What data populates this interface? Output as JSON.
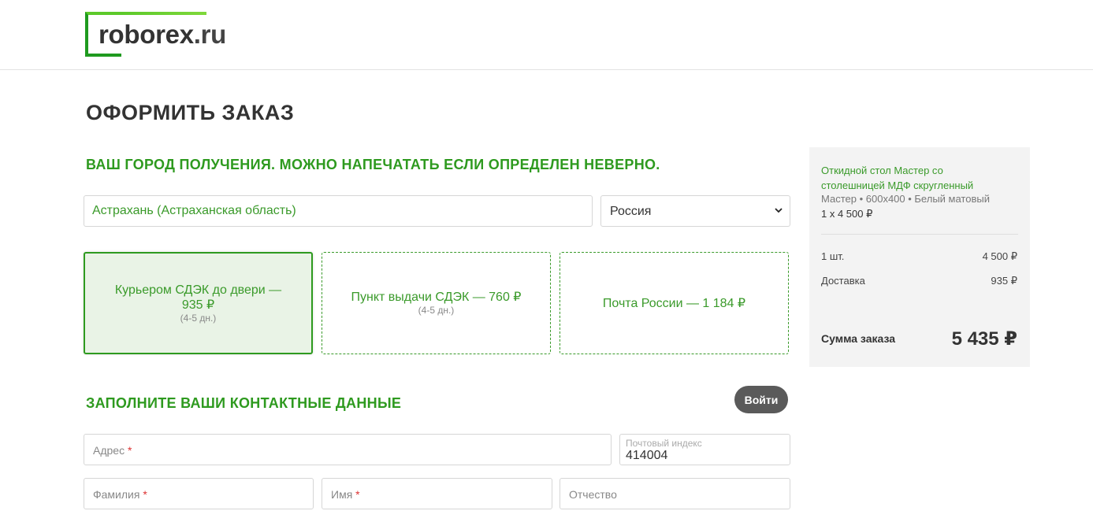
{
  "header": {
    "logo_main": "roborex",
    "logo_tld": ".ru"
  },
  "page": {
    "title": "ОФОРМИТЬ ЗАКАЗ"
  },
  "city_section": {
    "title": "ВАШ ГОРОД ПОЛУЧЕНИЯ. МОЖНО НАПЕЧАТАТЬ ЕСЛИ ОПРЕДЕЛЕН НЕВЕРНО.",
    "city_value": "Астрахань (Астраханская область)",
    "country_selected": "Россия"
  },
  "delivery_options": [
    {
      "label": "Курьером СДЭК до двери — 935 ₽",
      "term": "(4-5 дн.)",
      "selected": true
    },
    {
      "label": "Пункт выдачи СДЭК — 760 ₽",
      "term": "(4-5 дн.)",
      "selected": false
    },
    {
      "label": "Почта России — 1 184 ₽",
      "term": "",
      "selected": false
    }
  ],
  "contacts_section": {
    "title": "ЗАПОЛНИТЕ ВАШИ КОНТАКТНЫЕ ДАННЫЕ",
    "login_label": "Войти",
    "address_placeholder": "Адрес",
    "postal_label": "Почтовый индекс",
    "postal_value": "414004",
    "lastname_placeholder": "Фамилия",
    "firstname_placeholder": "Имя",
    "middlename_placeholder": "Отчество",
    "required_mark": "*"
  },
  "summary": {
    "product_name": "Откидной стол Мастер со столешницей МДФ скругленный",
    "product_spec": "Мастер • 600x400 • Белый матовый",
    "product_qty": "1 x 4 500 ₽",
    "qty_label": "1 шт.",
    "qty_value": "4 500 ₽",
    "delivery_label": "Доставка",
    "delivery_value": "935 ₽",
    "total_label": "Сумма заказа",
    "total_value": "5 435 ₽"
  },
  "colors": {
    "accent_green": "#2e9a1f",
    "selected_bg": "#e9f3e6",
    "button_dark": "#5a5a5a"
  }
}
